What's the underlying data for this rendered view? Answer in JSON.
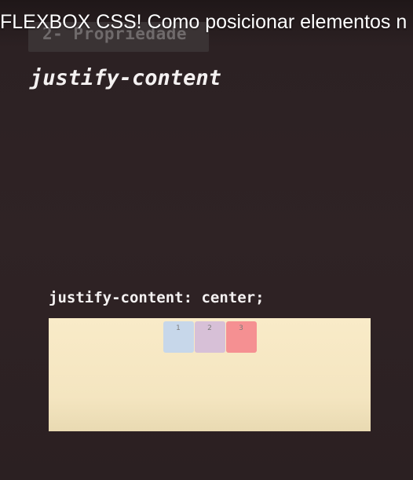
{
  "video": {
    "title": "FLEXBOX CSS! Como posicionar elementos n"
  },
  "slide": {
    "chapter_label": "2- Propriedade",
    "heading": "justify-content",
    "code": "justify-content: center;",
    "demo": {
      "items": [
        {
          "label": "1",
          "color": "#c7d7ea"
        },
        {
          "label": "2",
          "color": "#d7c0d7"
        },
        {
          "label": "3",
          "color": "#f59092"
        }
      ]
    }
  },
  "colors": {
    "background": "#2f2224",
    "container": "#f7e9c4"
  }
}
